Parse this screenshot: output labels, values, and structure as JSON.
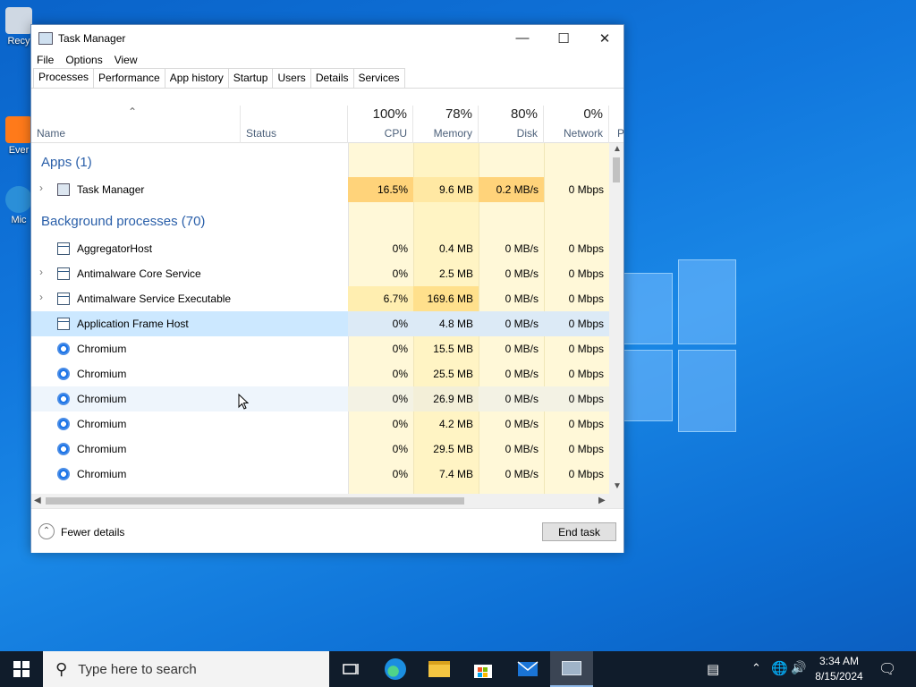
{
  "desktop": {
    "icons": [
      {
        "label": "Recy"
      },
      {
        "label": "Ever"
      },
      {
        "label": "Mic"
      }
    ]
  },
  "window": {
    "title": "Task Manager",
    "menu": [
      "File",
      "Options",
      "View"
    ],
    "tabs": [
      "Processes",
      "Performance",
      "App history",
      "Startup",
      "Users",
      "Details",
      "Services"
    ],
    "active_tab": "Processes",
    "columns": {
      "name": "Name",
      "status": "Status",
      "cpu": {
        "pct": "100%",
        "label": "CPU"
      },
      "memory": {
        "pct": "78%",
        "label": "Memory"
      },
      "disk": {
        "pct": "80%",
        "label": "Disk"
      },
      "network": {
        "pct": "0%",
        "label": "Network"
      },
      "next": "P"
    },
    "groups": {
      "apps": "Apps (1)",
      "background": "Background processes (70)"
    },
    "rows": [
      {
        "name": "Task Manager",
        "cpu": "16.5%",
        "memory": "9.6 MB",
        "disk": "0.2 MB/s",
        "network": "0 Mbps"
      },
      {
        "name": "AggregatorHost",
        "cpu": "0%",
        "memory": "0.4 MB",
        "disk": "0 MB/s",
        "network": "0 Mbps"
      },
      {
        "name": "Antimalware Core Service",
        "cpu": "0%",
        "memory": "2.5 MB",
        "disk": "0 MB/s",
        "network": "0 Mbps"
      },
      {
        "name": "Antimalware Service Executable",
        "cpu": "6.7%",
        "memory": "169.6 MB",
        "disk": "0 MB/s",
        "network": "0 Mbps"
      },
      {
        "name": "Application Frame Host",
        "cpu": "0%",
        "memory": "4.8 MB",
        "disk": "0 MB/s",
        "network": "0 Mbps"
      },
      {
        "name": "Chromium",
        "cpu": "0%",
        "memory": "15.5 MB",
        "disk": "0 MB/s",
        "network": "0 Mbps"
      },
      {
        "name": "Chromium",
        "cpu": "0%",
        "memory": "25.5 MB",
        "disk": "0 MB/s",
        "network": "0 Mbps"
      },
      {
        "name": "Chromium",
        "cpu": "0%",
        "memory": "26.9 MB",
        "disk": "0 MB/s",
        "network": "0 Mbps"
      },
      {
        "name": "Chromium",
        "cpu": "0%",
        "memory": "4.2 MB",
        "disk": "0 MB/s",
        "network": "0 Mbps"
      },
      {
        "name": "Chromium",
        "cpu": "0%",
        "memory": "29.5 MB",
        "disk": "0 MB/s",
        "network": "0 Mbps"
      },
      {
        "name": "Chromium",
        "cpu": "0%",
        "memory": "7.4 MB",
        "disk": "0 MB/s",
        "network": "0 Mbps"
      }
    ],
    "footer": {
      "fewer_details": "Fewer details",
      "end_task": "End task"
    }
  },
  "taskbar": {
    "search_placeholder": "Type here to search",
    "time": "3:34 AM",
    "date": "8/15/2024"
  },
  "colors": {
    "heat_low": "#fff4c4",
    "heat_mid": "#ffe8a3",
    "heat_high": "#ffd37a",
    "selected_row": "#cce8ff",
    "hover_row": "#e5f3ff",
    "group_text": "#2a5fa9"
  }
}
